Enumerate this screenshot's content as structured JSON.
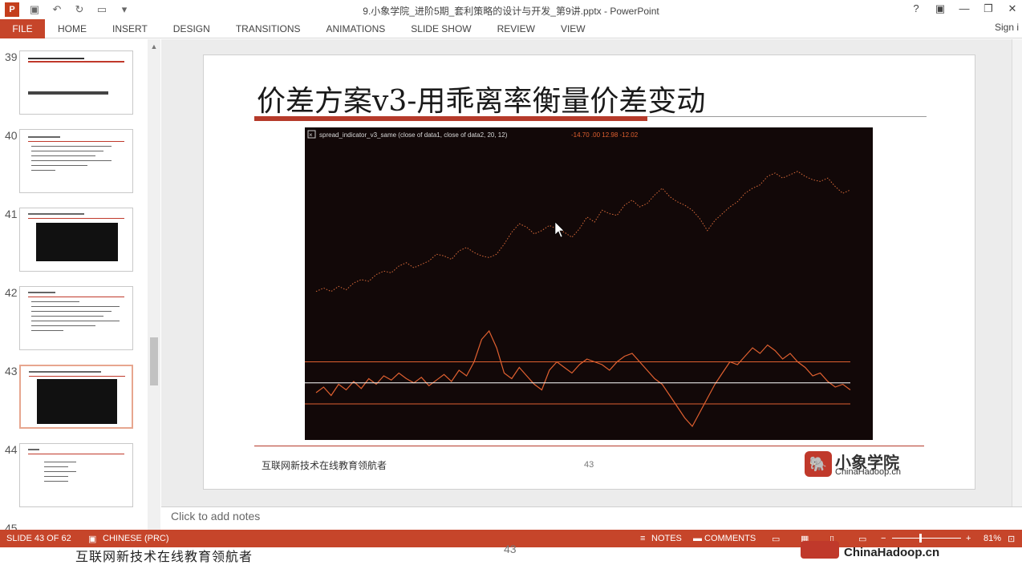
{
  "window": {
    "title": "9.小象学院_进阶5期_套利策略的设计与开发_第9讲.pptx - PowerPoint",
    "help": "?",
    "minimize": "—",
    "restore": "❐",
    "close": "✕"
  },
  "ribbon": {
    "file": "FILE",
    "tabs": [
      "HOME",
      "INSERT",
      "DESIGN",
      "TRANSITIONS",
      "ANIMATIONS",
      "SLIDE SHOW",
      "REVIEW",
      "VIEW"
    ],
    "signin": "Sign i"
  },
  "thumbnails": [
    {
      "num": "39"
    },
    {
      "num": "40"
    },
    {
      "num": "41"
    },
    {
      "num": "42"
    },
    {
      "num": "43"
    },
    {
      "num": "44"
    },
    {
      "num": "45"
    }
  ],
  "slide": {
    "title": "价差方案v3-用乖离率衡量价差变动",
    "footer_text": "互联网新技术在线教育领航者",
    "page_number": "43",
    "logo_cn": "小象学院",
    "logo_en": "ChinaHadoop.cn",
    "logo_icon": "elephant-icon"
  },
  "chart_data": {
    "type": "line",
    "legend": "spread_indicator_v3_same   (close of data1,  close of data2, 20, 12)",
    "readout": "-14.70   .00   12.98   -12.02",
    "background": "#120808",
    "series": [
      {
        "color": "#d96a3a",
        "values": [
          12,
          14,
          12,
          15,
          13,
          17,
          19,
          18,
          22,
          24,
          23,
          27,
          29,
          26,
          28,
          30,
          34,
          33,
          31,
          36,
          38,
          35,
          33,
          32,
          34,
          40,
          47,
          52,
          50,
          46,
          48,
          51,
          49,
          47,
          44,
          49,
          56,
          53,
          60,
          58,
          57,
          63,
          66,
          62,
          64,
          69,
          73,
          68,
          65,
          63,
          60,
          55,
          48,
          54,
          58,
          62,
          65,
          70,
          73,
          75,
          80,
          82,
          79,
          81,
          83,
          80,
          78,
          77,
          79,
          74,
          70,
          72
        ]
      },
      {
        "color": "#e06030",
        "values": [
          8,
          12,
          6,
          14,
          10,
          16,
          11,
          18,
          14,
          20,
          17,
          22,
          18,
          15,
          19,
          13,
          17,
          21,
          16,
          24,
          20,
          30,
          46,
          52,
          40,
          22,
          18,
          26,
          20,
          14,
          10,
          24,
          30,
          26,
          22,
          28,
          32,
          30,
          28,
          24,
          30,
          34,
          36,
          30,
          24,
          18,
          14,
          6,
          -2,
          -10,
          -16,
          -6,
          4,
          14,
          22,
          30,
          28,
          34,
          40,
          36,
          42,
          38,
          32,
          36,
          30,
          26,
          20,
          22,
          16,
          12,
          14,
          10
        ]
      }
    ],
    "reference_lines": [
      {
        "value": 30,
        "color": "#e06030"
      },
      {
        "value": 15,
        "color": "#ffffff"
      },
      {
        "value": 0,
        "color": "#e06030"
      }
    ]
  },
  "notes": {
    "placeholder": "Click to add notes"
  },
  "status": {
    "slide": "SLIDE 43 OF 62",
    "language": "CHINESE (PRC)",
    "notes": "NOTES",
    "comments": "COMMENTS",
    "zoom": "81%"
  },
  "overlay": {
    "text": "互联网新技术在线教育领航者",
    "page": "43",
    "brand": "ChinaHadoop.cn"
  }
}
